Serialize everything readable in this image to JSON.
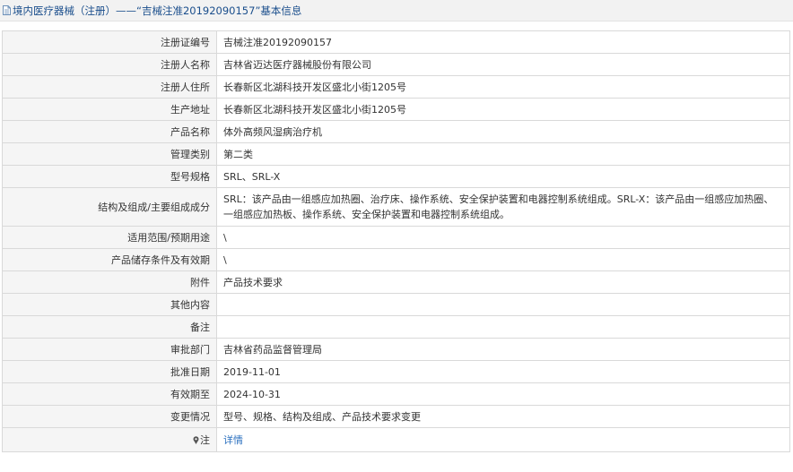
{
  "header": {
    "title": "境内医疗器械（注册）——“吉械注准20192090157”基本信息"
  },
  "rows": [
    {
      "label": "注册证编号",
      "value": "吉械注准20192090157"
    },
    {
      "label": "注册人名称",
      "value": "吉林省迈达医疗器械股份有限公司"
    },
    {
      "label": "注册人住所",
      "value": "长春新区北湖科技开发区盛北小街1205号"
    },
    {
      "label": "生产地址",
      "value": "长春新区北湖科技开发区盛北小街1205号"
    },
    {
      "label": "产品名称",
      "value": "体外高频风湿病治疗机"
    },
    {
      "label": "管理类别",
      "value": "第二类"
    },
    {
      "label": "型号规格",
      "value": "SRL、SRL-X"
    },
    {
      "label": "结构及组成/主要组成成分",
      "value": "SRL：该产品由一组感应加热圈、治疗床、操作系统、安全保护装置和电器控制系统组成。SRL-X：该产品由一组感应加热圈、一组感应加热板、操作系统、安全保护装置和电器控制系统组成。"
    },
    {
      "label": "适用范围/预期用途",
      "value": "\\"
    },
    {
      "label": "产品储存条件及有效期",
      "value": "\\"
    },
    {
      "label": "附件",
      "value": "产品技术要求"
    },
    {
      "label": "其他内容",
      "value": ""
    },
    {
      "label": "备注",
      "value": ""
    },
    {
      "label": "审批部门",
      "value": "吉林省药品监督管理局"
    },
    {
      "label": "批准日期",
      "value": "2019-11-01"
    },
    {
      "label": "有效期至",
      "value": "2024-10-31"
    },
    {
      "label": "变更情况",
      "value": "型号、规格、结构及组成、产品技术要求变更"
    }
  ],
  "note": {
    "label": "注",
    "link_text": "详情",
    "icon": "pin-icon"
  },
  "colors": {
    "title": "#1a4e8c",
    "link": "#2a6fbf",
    "label_bg": "#f5f5f5",
    "border": "#d9d9d9"
  }
}
